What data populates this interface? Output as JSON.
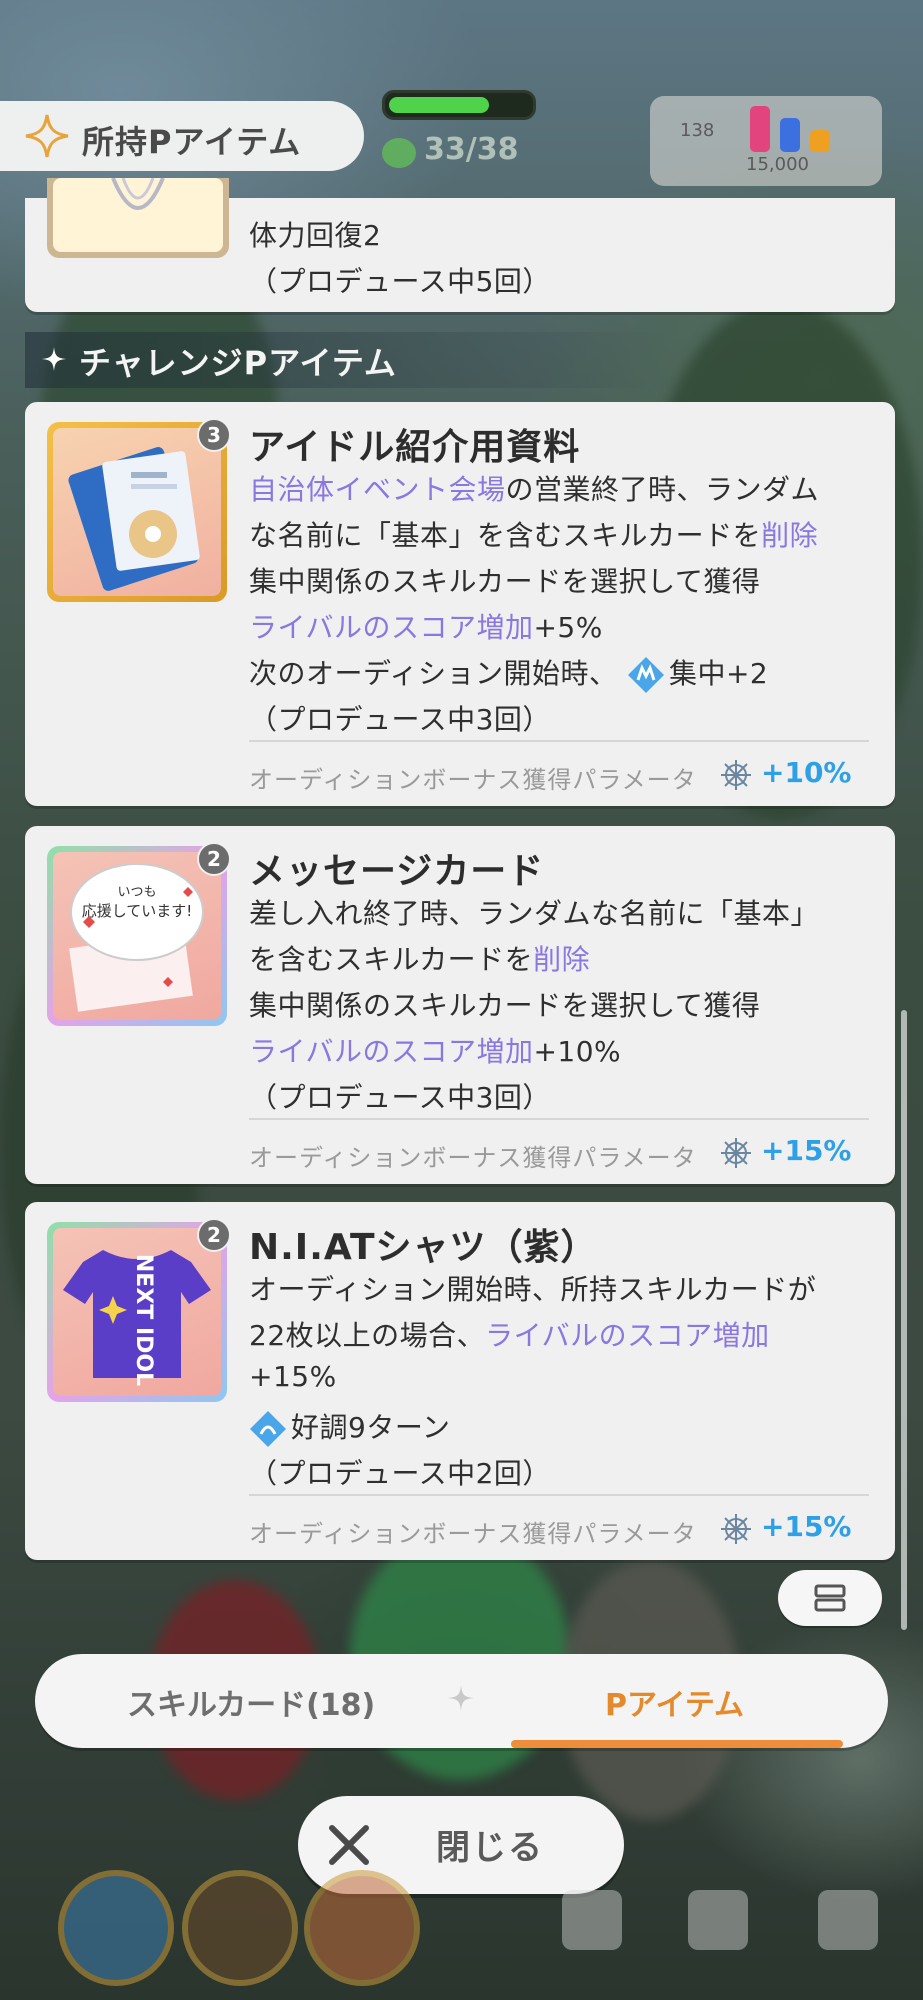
{
  "header": {
    "title": "所持Pアイテム"
  },
  "hud": {
    "hp_text": "33/38",
    "currency_text": "15,000",
    "trb_label": "138"
  },
  "prev_item": {
    "line1": "体力回復2",
    "line2": "（プロデュース中5回）"
  },
  "section": {
    "label": "チャレンジPアイテム"
  },
  "items": [
    {
      "title": "アイドル紹介用資料",
      "count": "3",
      "l1_hl": "自治体イベント会場",
      "l1_rest": "の営業終了時、ランダム",
      "l2_pre": "な名前に「基本」を含むスキルカードを",
      "l2_hl": "削除",
      "l3": "集中関係のスキルカードを選択して獲得",
      "l4_hl": "ライバルのスコア増加",
      "l4_rest": "+5%",
      "l5_pre": "次のオーディション開始時、",
      "l5_chip": "集中+2",
      "l6": "（プロデュース中3回）",
      "bonus_label": "オーディションボーナス獲得パラメータ",
      "bonus_value": "+10%"
    },
    {
      "title": "メッセージカード",
      "count": "2",
      "l1": "差し入れ終了時、ランダムな名前に「基本」",
      "l2_pre": "を含むスキルカードを",
      "l2_hl": "削除",
      "l3": "集中関係のスキルカードを選択して獲得",
      "l4_hl": "ライバルのスコア増加",
      "l4_rest": "+10%",
      "l5": "（プロデュース中3回）",
      "bonus_label": "オーディションボーナス獲得パラメータ",
      "bonus_value": "+15%",
      "card_text1": "いつも",
      "card_text2": "応援しています!"
    },
    {
      "title": "N.I.ATシャツ（紫）",
      "count": "2",
      "l1": "オーディション開始時、所持スキルカードが",
      "l2_pre": "22枚以上の場合、",
      "l2_hl": "ライバルのスコア増加",
      "l3": "+15%",
      "l4_chip": "好調9ターン",
      "l5": "（プロデュース中2回）",
      "bonus_label": "オーディションボーナス獲得パラメータ",
      "bonus_value": "+15%",
      "shirt_text": "NEXT IDOL"
    }
  ],
  "tabs": {
    "skill": "スキルカード(18)",
    "pitem": "Pアイテム"
  },
  "close": {
    "label": "閉じる"
  },
  "colors": {
    "accent": "#ef8e3a",
    "highlight": "#8a77e0",
    "bonus": "#2da0e6"
  }
}
